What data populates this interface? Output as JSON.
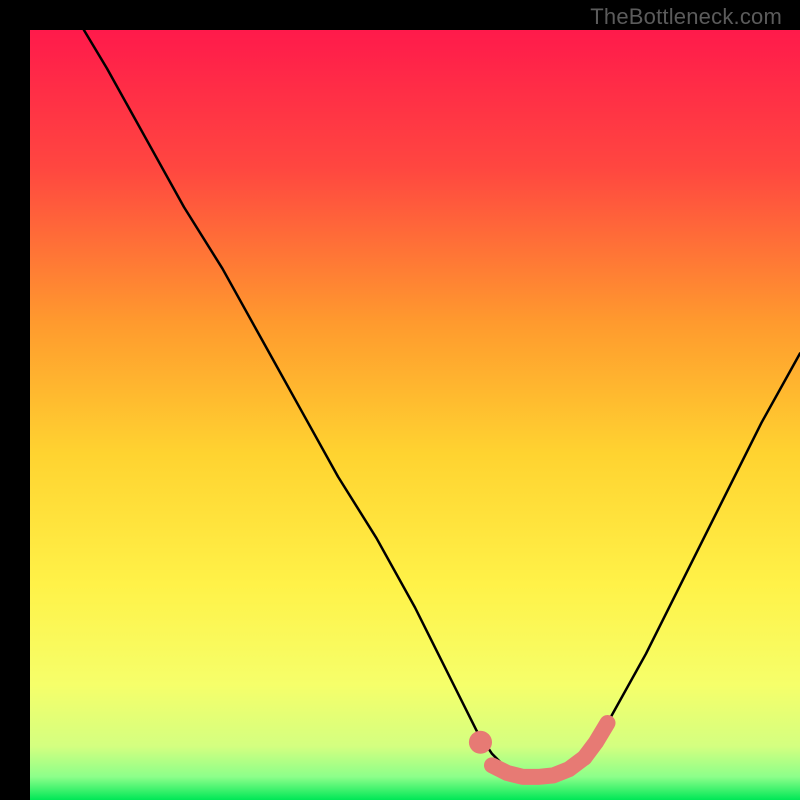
{
  "watermark": "TheBottleneck.com",
  "colors": {
    "black": "#000000",
    "curve": "#000000",
    "marker": "#e77a74",
    "grad_top": "#ff1a4b",
    "grad_mid1": "#ff5a3a",
    "grad_mid2": "#ffb326",
    "grad_mid3": "#ffe63a",
    "grad_mid4": "#fdfc60",
    "grad_mid5": "#e9ff72",
    "grad_bot": "#00e756"
  },
  "chart_data": {
    "type": "line",
    "title": "",
    "xlabel": "",
    "ylabel": "",
    "xlim": [
      0,
      100
    ],
    "ylim": [
      0,
      100
    ],
    "series": [
      {
        "name": "bottleneck-curve",
        "x": [
          7,
          10,
          15,
          20,
          25,
          30,
          35,
          40,
          45,
          50,
          55,
          58,
          60,
          62,
          64,
          66,
          68,
          70,
          72,
          75,
          80,
          85,
          90,
          95,
          100
        ],
        "y": [
          100,
          95,
          86,
          77,
          69,
          60,
          51,
          42,
          34,
          25,
          15,
          9,
          6,
          4,
          3,
          3,
          3,
          4,
          6,
          10,
          19,
          29,
          39,
          49,
          58
        ]
      }
    ],
    "markers": [
      {
        "name": "marker-left-dot",
        "shape": "circle",
        "x": 58.5,
        "y": 7.5,
        "r": 1.5
      },
      {
        "name": "marker-plateau",
        "shape": "thickline",
        "x": [
          60,
          62,
          64,
          66,
          68,
          70,
          72
        ],
        "y": [
          4.5,
          3.5,
          3.0,
          3.0,
          3.2,
          4.0,
          5.5
        ]
      },
      {
        "name": "marker-right-cluster",
        "shape": "thickline",
        "x": [
          72,
          73.5,
          75
        ],
        "y": [
          5.5,
          7.5,
          10
        ]
      }
    ]
  }
}
